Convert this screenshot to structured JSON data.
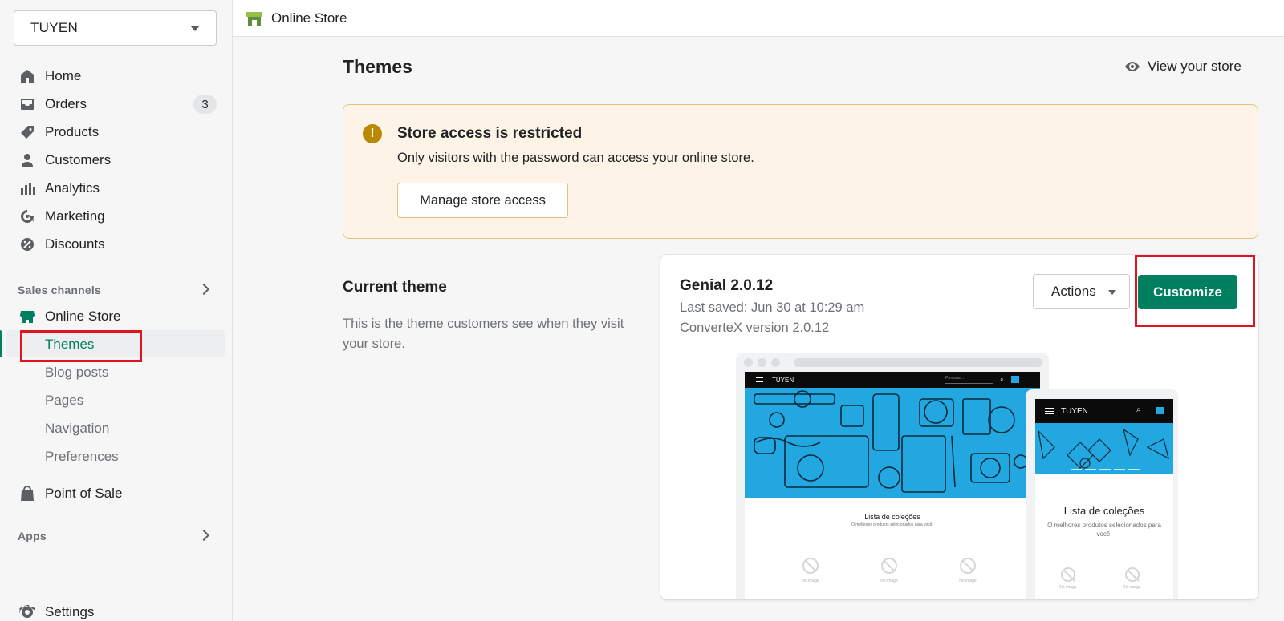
{
  "store": {
    "name": "TUYEN"
  },
  "nav": {
    "home": "Home",
    "orders": "Orders",
    "orders_count": "3",
    "products": "Products",
    "customers": "Customers",
    "analytics": "Analytics",
    "marketing": "Marketing",
    "discounts": "Discounts",
    "sales_channels": "Sales channels",
    "online_store": "Online Store",
    "sub": [
      "Themes",
      "Blog posts",
      "Pages",
      "Navigation",
      "Preferences"
    ],
    "point_of_sale": "Point of Sale",
    "apps": "Apps",
    "settings": "Settings"
  },
  "topbar": {
    "title": "Online Store"
  },
  "page": {
    "title": "Themes",
    "view_store": "View your store"
  },
  "banner": {
    "title": "Store access is restricted",
    "text": "Only visitors with the password can access your online store.",
    "button": "Manage store access"
  },
  "current_theme": {
    "title": "Current theme",
    "description": "This is the theme customers see when they visit your store.",
    "name": "Genial 2.0.12",
    "last_saved": "Last saved: Jun 30 at 10:29 am",
    "version": "ConverteX version 2.0.12",
    "actions_label": "Actions",
    "customize_label": "Customize"
  },
  "preview": {
    "store_name": "TUYEN",
    "collection_title": "Lista de coleções",
    "collection_sub": "O melhores produtos selecionados para você!",
    "no_image": "No image",
    "search_placeholder": "Procurar..."
  },
  "colors": {
    "accent": "#008060",
    "highlight": "#e0141e",
    "banner_bg": "#fdf4e7",
    "hero_bg": "#22a7e0"
  }
}
